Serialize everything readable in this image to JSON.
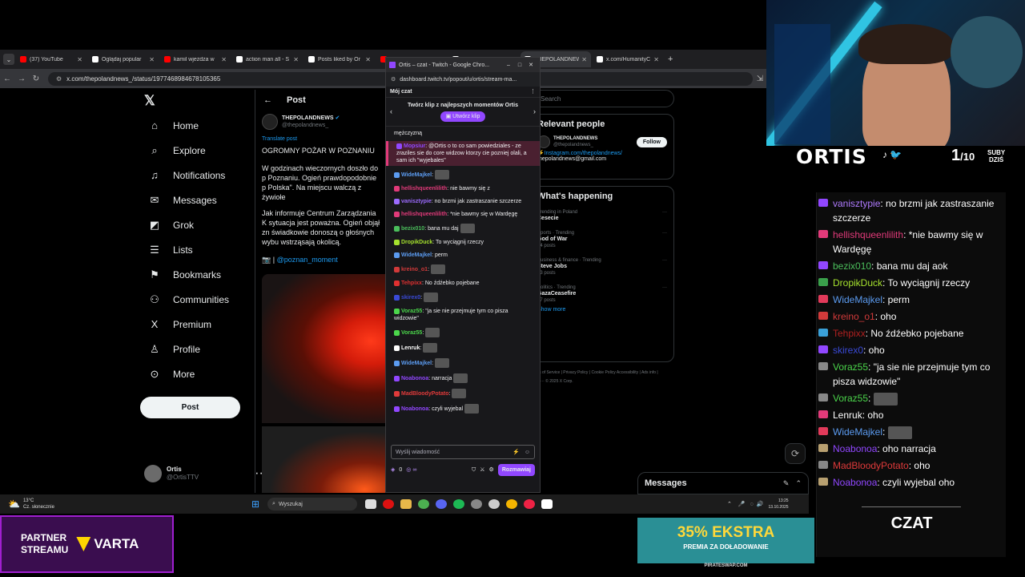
{
  "browser": {
    "tabs": [
      {
        "label": "(37) YouTube",
        "color": "#ff0000"
      },
      {
        "label": "Oglądaj popular",
        "color": "#ffffff"
      },
      {
        "label": "kamil wjeżdża w",
        "color": "#ff0000"
      },
      {
        "label": "action man all - S",
        "color": "#ffffff"
      },
      {
        "label": "Posts liked by Or",
        "color": "#ffffff"
      },
      {
        "label": "",
        "color": "#ff0000"
      },
      {
        "label": "al_whales o",
        "color": "#ffffff"
      },
      {
        "label": "THEPOLANDNEWS",
        "color": "#ffffff"
      },
      {
        "label": "x.com/HumanityC",
        "color": "#ffffff"
      }
    ],
    "url": "x.com/thepolandnews_/status/1977468984678105365"
  },
  "x": {
    "nav": [
      {
        "label": "Home",
        "icon": "home-icon",
        "glyph": "⌂"
      },
      {
        "label": "Explore",
        "icon": "search-icon",
        "glyph": "⌕"
      },
      {
        "label": "Notifications",
        "icon": "bell-icon",
        "glyph": "♫"
      },
      {
        "label": "Messages",
        "icon": "envelope-icon",
        "glyph": "✉"
      },
      {
        "label": "Grok",
        "icon": "grok-icon",
        "glyph": "◩"
      },
      {
        "label": "Lists",
        "icon": "list-icon",
        "glyph": "☰"
      },
      {
        "label": "Bookmarks",
        "icon": "bookmark-icon",
        "glyph": "⚑"
      },
      {
        "label": "Communities",
        "icon": "people-icon",
        "glyph": "⚇"
      },
      {
        "label": "Premium",
        "icon": "x-logo-icon",
        "glyph": "X"
      },
      {
        "label": "Profile",
        "icon": "person-icon",
        "glyph": "♙"
      },
      {
        "label": "More",
        "icon": "more-circle-icon",
        "glyph": "⊙"
      }
    ],
    "post_button": "Post",
    "profile": {
      "name": "Ortis",
      "handle": "@OrtisTTV"
    },
    "post_header": "Post",
    "author_name": "THEPOLANDNEWS",
    "author_handle": "@thepolandnews_",
    "translate": "Translate post",
    "headline": "OGROMNY POŻAR W POZNANIU",
    "p1": "W godzinach wieczornych doszło do p Poznaniu. Ogień prawdopodobnie p Polska\". Na miejscu walczą z żywiołe",
    "p2": "Jak informuje Centrum Zarządzania K sytuacja jest poważna. Ogień objął zn świadkowie donoszą o głośnych wybu wstrząsają okolicą.",
    "source": "@poznan_moment",
    "search": "Search",
    "relevant": "Relevant people",
    "rp_name": "THEPOLANDNEWS",
    "rp_handle": "@thepolandnews_",
    "follow": "Follow",
    "rp_link1": "Instagram.com/thepolandnews/",
    "rp_link2": "thepolandnews@gmail.com",
    "happening": "What's happening",
    "trends": [
      {
        "meta": "Trending in Poland",
        "title": "Cesecie",
        "posts": ""
      },
      {
        "meta": "Sports · Trending",
        "title": "God of War",
        "posts": "34 posts"
      },
      {
        "meta": "Business & finance · Trending",
        "title": "Steve Jobs",
        "posts": "73 posts"
      },
      {
        "meta": "Politics · Trending",
        "title": "GazaCeasefire",
        "posts": "37 posts"
      }
    ],
    "show_more": "Show more",
    "footer": "Terms of Service  |  Privacy Policy  |  Cookie Policy  Accessibility  |  Ads info  |  More ···  © 2025 X Corp."
  },
  "twitch": {
    "window_title": "Ortis – czat - Twitch - Google Chro...",
    "url": "dashboard.twitch.tv/popout/u/ortis/stream-ma...",
    "chat_title": "Mój czat",
    "clip_banner": "Twórz klip z najlepszych momentów Ortis",
    "clip_button": "Utwórz klip",
    "messages": [
      {
        "user": "",
        "color": "#ffffff",
        "text": "mężczyzną"
      },
      {
        "user": "Mopsiur",
        "color": "#9147ff",
        "text": ": @Ortis o to co sam powiedziales - ze zraziles sie do core widzow ktorzy cie pozniej olali, a sam ich \"wyjebales\""
      },
      {
        "user": "WideMajkel",
        "color": "#5b9bf0",
        "text": ":"
      },
      {
        "user": "hellishqueenlilith",
        "color": "#e23a7a",
        "text": ": nie bawmy się z"
      },
      {
        "user": "vanisztypie",
        "color": "#9c6bff",
        "text": ": no brzmi jak zastraszanie szczerze"
      },
      {
        "user": "hellishqueenlilith",
        "color": "#e23a7a",
        "text": ": *nie bawmy się w Wardęgę"
      },
      {
        "user": "bezix010",
        "color": "#4bbf5c",
        "text": ": bana mu daj"
      },
      {
        "user": "DropikDuck",
        "color": "#a6e22e",
        "text": ": To wyciągnij rzeczy"
      },
      {
        "user": "WideMajkel",
        "color": "#5b9bf0",
        "text": ": perm"
      },
      {
        "user": "kreino_o1",
        "color": "#d13a3a",
        "text": ":"
      },
      {
        "user": "Tehpixx",
        "color": "#e03030",
        "text": ": No źdźebko pojebane"
      },
      {
        "user": "skirex0",
        "color": "#3a4ad8",
        "text": ":"
      },
      {
        "user": "Voraz55",
        "color": "#4bd64b",
        "text": ": \"ja sie nie przejmuje tym co pisza widzowie\""
      },
      {
        "user": "Voraz55",
        "color": "#4bd64b",
        "text": ":"
      },
      {
        "user": "Lenruk",
        "color": "#ffffff",
        "text": ":"
      },
      {
        "user": "WideMajkel",
        "color": "#5b9bf0",
        "text": ":"
      },
      {
        "user": "Noabonoa",
        "color": "#9147ff",
        "text": ": narracja"
      },
      {
        "user": "MadBloodyPotato",
        "color": "#e03a3a",
        "text": ":"
      },
      {
        "user": "Noabonoa",
        "color": "#9147ff",
        "text": ": czyli wyjebal"
      }
    ],
    "input_placeholder": "Wyślij wiadomość",
    "points": "0",
    "send_button": "Rozmawiaj"
  },
  "overlay": {
    "streamer_name": "ORTIS",
    "subs_count": "1",
    "subs_total": "/10",
    "subs_label": "SUBY",
    "subs_sublabel": "DZIŚ",
    "chat_label": "CZAT",
    "chat": [
      {
        "user": "vanisztypie",
        "color": "#b07bff",
        "text": ": no brzmi jak zastraszanie szczerze",
        "badge": "#9147ff"
      },
      {
        "user": "hellishqueenlilith",
        "color": "#e23a7a",
        "text": ": *nie bawmy się w Wardęgę",
        "badge": "#e23a7a"
      },
      {
        "user": "bezix010",
        "color": "#4bbf5c",
        "text": ": bana mu daj aok",
        "badge": "#9147ff"
      },
      {
        "user": "DropikDuck",
        "color": "#a6e22e",
        "text": ": To wyciągnij rzeczy",
        "badge": "#3aa04b"
      },
      {
        "user": "WideMajkel",
        "color": "#5b9bf0",
        "text": ": perm",
        "badge": "#e23a5a"
      },
      {
        "user": "kreino_o1",
        "color": "#d13a3a",
        "text": ": oho",
        "badge": "#d13a3a"
      },
      {
        "user": "Tehpixx",
        "color": "#b02020",
        "text": ": No źdźebko pojebane",
        "badge": "#3aa0d8"
      },
      {
        "user": "skirex0",
        "color": "#3a4ad8",
        "text": ": oho",
        "badge": "#9147ff"
      },
      {
        "user": "Voraz55",
        "color": "#4bd64b",
        "text": ": \"ja sie nie przejmuje tym co pisza widzowie\"",
        "badge": "#888888"
      },
      {
        "user": "Voraz55",
        "color": "#4bd64b",
        "text": ":",
        "badge": "#888888"
      },
      {
        "user": "Lenruk",
        "color": "#ffffff",
        "text": ": oho",
        "badge": "#e23a7a"
      },
      {
        "user": "WideMajkel",
        "color": "#5b9bf0",
        "text": ":",
        "badge": "#e23a5a"
      },
      {
        "user": "Noabonoa",
        "color": "#9147ff",
        "text": ": oho narracja",
        "badge": "#b8a070"
      },
      {
        "user": "MadBloodyPotato",
        "color": "#e03a3a",
        "text": ": oho",
        "badge": "#888888"
      },
      {
        "user": "Noabonoa",
        "color": "#9147ff",
        "text": ": czyli wyjebal oho",
        "badge": "#b8a070"
      }
    ]
  },
  "messages_bar": "Messages",
  "taskbar": {
    "temp": "13°C",
    "weather": "Cz. słonecznie",
    "search": "Wyszukaj",
    "time": "13:25",
    "date": "13.10.2025"
  },
  "banner": {
    "partner": "PARTNER\nSTREAMU",
    "brand": "VARTA",
    "promo_big": "35% EKSTRA",
    "promo_small": "PREMIA ZA DOŁADOWANIE",
    "promo_site": "PIRATESWAP.COM"
  }
}
